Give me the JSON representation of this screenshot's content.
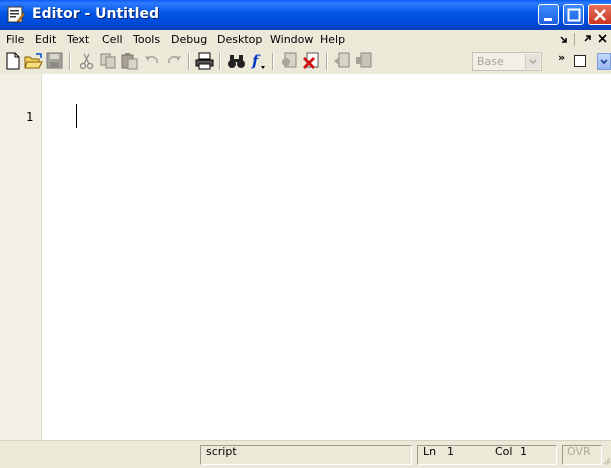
{
  "window": {
    "title": "Editor - Untitled",
    "icon": "editor-document-icon"
  },
  "menubar": {
    "items": [
      {
        "label": "File"
      },
      {
        "label": "Edit"
      },
      {
        "label": "Text"
      },
      {
        "label": "Cell"
      },
      {
        "label": "Tools"
      },
      {
        "label": "Debug"
      },
      {
        "label": "Desktop"
      },
      {
        "label": "Window"
      },
      {
        "label": "Help"
      }
    ],
    "dock_controls": [
      "undock-arrow-icon",
      "restore-arrow-icon",
      "close-x-icon"
    ]
  },
  "toolbar": {
    "icons": [
      "new-file-icon",
      "open-folder-icon",
      "save-disk-icon",
      "cut-scissors-icon",
      "copy-icon",
      "paste-icon",
      "undo-icon",
      "redo-icon",
      "print-icon",
      "find-binoculars-icon",
      "function-icon",
      "set-breakpoint-icon",
      "clear-breakpoint-icon",
      "step-icon",
      "step-out-icon"
    ],
    "stack_dropdown": "Base",
    "overflow_chevron": "»"
  },
  "editor": {
    "line_numbers": [
      "1"
    ],
    "content": ""
  },
  "statusbar": {
    "mode": "script",
    "line_label": "Ln",
    "line_value": "1",
    "col_label": "Col",
    "col_value": "1",
    "overwrite": "OVR"
  }
}
